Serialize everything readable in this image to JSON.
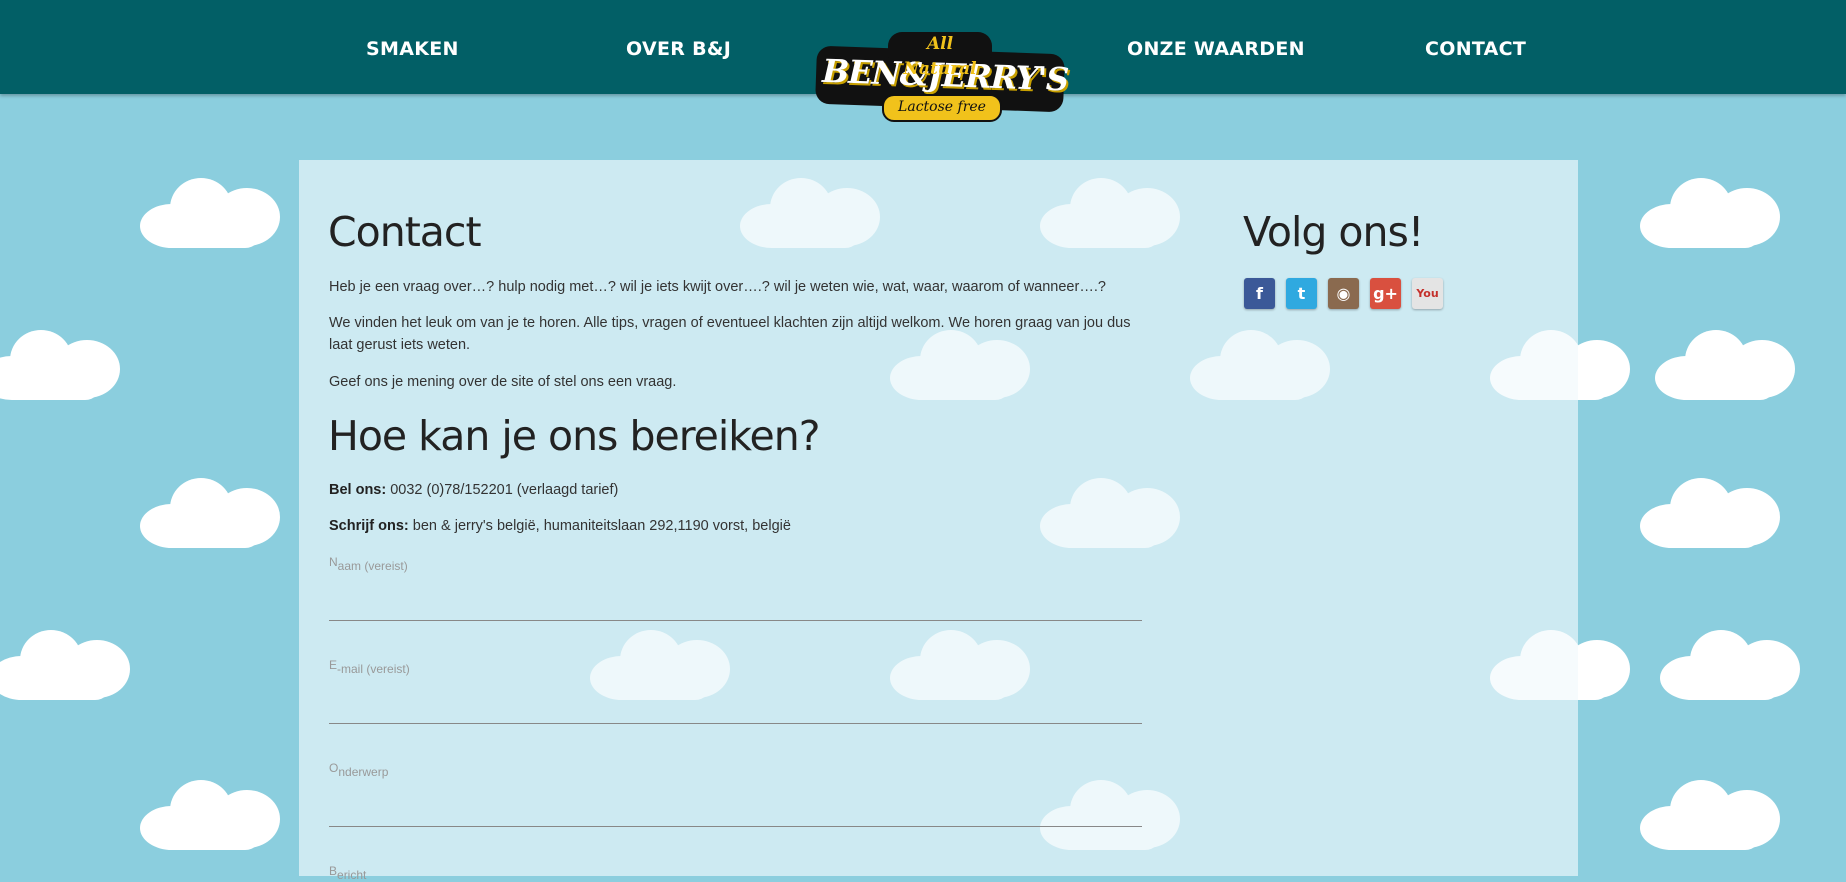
{
  "nav": {
    "items": [
      "SMAKEN",
      "OVER B&J",
      "ONZE WAARDEN",
      "CONTACT"
    ]
  },
  "logo": {
    "top": "All Natural",
    "main": "BEN&JERRY'S",
    "sub": "Lactose free"
  },
  "contact": {
    "title": "Contact",
    "intro_1": "Heb je een vraag over…? hulp nodig met…? wil je iets kwijt over….? wil je weten wie, wat, waar, waarom of wanneer….?",
    "intro_2": "We vinden het leuk om van je te horen. Alle tips, vragen of eventueel klachten zijn altijd welkom. We horen graag van jou dus laat gerust iets weten.",
    "intro_3": "Geef ons je mening over de site of stel ons een vraag.",
    "reach_title": "Hoe kan je ons bereiken?",
    "call_label": "Bel ons:",
    "call_value": "0032 (0)78/152201 (verlaagd tarief)",
    "write_label": "Schrijf ons:",
    "write_value": "ben & jerry's belgië, humaniteitslaan 292,1190 vorst, belgië"
  },
  "form": {
    "fields": [
      {
        "first": "N",
        "rest": "aam (vereist)"
      },
      {
        "first": "E",
        "rest": "-mail (vereist)"
      },
      {
        "first": "O",
        "rest": "nderwerp"
      },
      {
        "first": "B",
        "rest": "ericht"
      }
    ]
  },
  "social": {
    "title": "Volg ons!",
    "items": [
      {
        "name": "facebook-icon",
        "glyph": "f",
        "color": "#3b5998"
      },
      {
        "name": "twitter-icon",
        "glyph": "t",
        "color": "#2fa9e0"
      },
      {
        "name": "instagram-icon",
        "glyph": "◉",
        "color": "#8a6a4f"
      },
      {
        "name": "google-plus-icon",
        "glyph": "g+",
        "color": "#d9503f"
      },
      {
        "name": "youtube-icon",
        "glyph": "You",
        "color": "#e4e4e4"
      }
    ]
  }
}
